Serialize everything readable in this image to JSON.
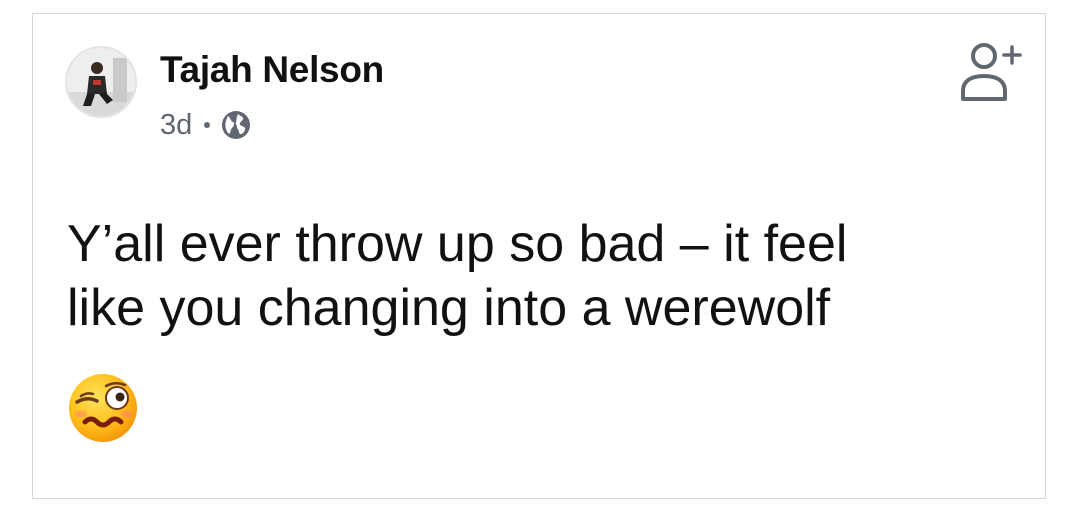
{
  "post": {
    "author": {
      "name": "Tajah Nelson",
      "avatar_icon": "profile-photo"
    },
    "meta": {
      "time": "3d",
      "audience_icon": "globe-icon"
    },
    "actions": {
      "follow_icon": "add-friend-icon"
    },
    "text": "Y’all ever throw up so bad – it feel\nlike you changing into a werewolf",
    "emoji": {
      "name": "face-with-uneven-eyes-and-wavy-mouth",
      "icon": "woozy-face-icon"
    }
  },
  "colors": {
    "text_primary": "#111111",
    "text_secondary": "#606770",
    "border": "#d6d6d6",
    "background": "#ffffff"
  }
}
